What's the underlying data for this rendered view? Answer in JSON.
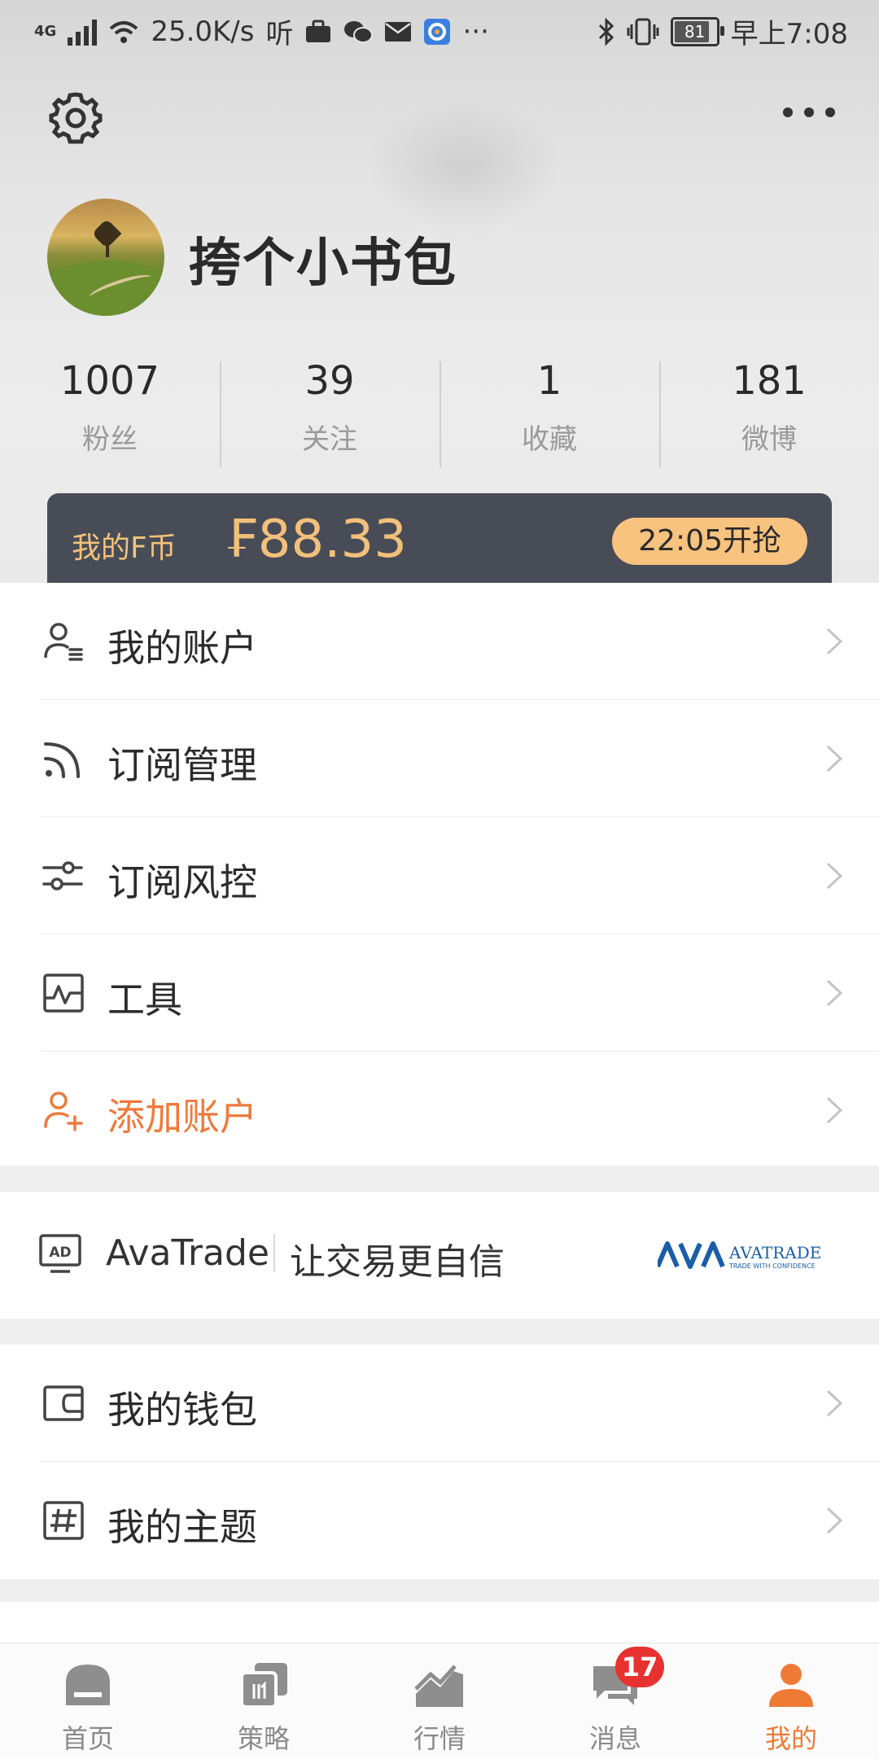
{
  "status_bar": {
    "network": "4G",
    "speed": "25.0K/s",
    "ting": "听",
    "more": "···",
    "battery": "81",
    "time": "早上7:08"
  },
  "profile": {
    "username": "挎个小书包",
    "stats": [
      {
        "value": "1007",
        "label": "粉丝"
      },
      {
        "value": "39",
        "label": "关注"
      },
      {
        "value": "1",
        "label": "收藏"
      },
      {
        "value": "181",
        "label": "微博"
      }
    ]
  },
  "coin_banner": {
    "label": "我的F币",
    "amount": "₣88.33",
    "button": "22:05开抢"
  },
  "menu_main": [
    {
      "label": "我的账户",
      "icon": "account-icon"
    },
    {
      "label": "订阅管理",
      "icon": "rss-icon"
    },
    {
      "label": "订阅风控",
      "icon": "sliders-icon"
    },
    {
      "label": "工具",
      "icon": "chart-tool-icon"
    },
    {
      "label": "添加账户",
      "icon": "add-user-icon"
    }
  ],
  "ad": {
    "brand": "AvaTrade",
    "slogan": "让交易更自信",
    "logo_text": "AVATRADE",
    "logo_sub": "TRADE WITH CONFIDENCE"
  },
  "menu_secondary": [
    {
      "label": "我的钱包",
      "icon": "wallet-icon"
    },
    {
      "label": "我的主题",
      "icon": "hashtag-icon"
    }
  ],
  "tabbar": {
    "tabs": [
      {
        "label": "首页",
        "icon": "home-icon"
      },
      {
        "label": "策略",
        "icon": "strategy-icon"
      },
      {
        "label": "行情",
        "icon": "market-icon"
      },
      {
        "label": "消息",
        "icon": "message-icon",
        "badge": "17"
      },
      {
        "label": "我的",
        "icon": "profile-icon"
      }
    ],
    "active_color": "#ef7a36"
  },
  "colors": {
    "accent": "#ee7a3c",
    "banner_bg": "#474c57",
    "banner_gold": "#f3c07a",
    "badge": "#e8322f"
  }
}
